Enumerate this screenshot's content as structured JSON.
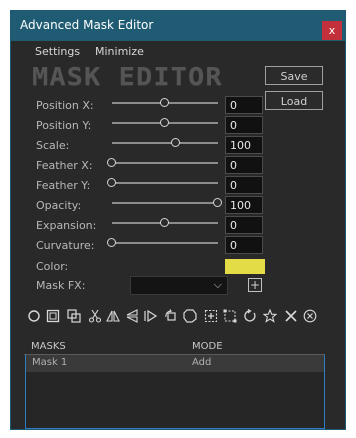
{
  "window": {
    "title": "Advanced Mask Editor",
    "close_label": "x"
  },
  "menu": {
    "settings": "Settings",
    "minimize": "Minimize"
  },
  "logo": "MASK EDITOR",
  "buttons": {
    "save": "Save",
    "load": "Load"
  },
  "params": [
    {
      "label": "Position X:",
      "value": "0",
      "level": 0.5
    },
    {
      "label": "Position Y:",
      "value": "0",
      "level": 0.5
    },
    {
      "label": "Scale:",
      "value": "100",
      "level": 0.6
    },
    {
      "label": "Feather X:",
      "value": "0",
      "level": 0.0
    },
    {
      "label": "Feather Y:",
      "value": "0",
      "level": 0.0
    },
    {
      "label": "Opacity:",
      "value": "100",
      "level": 1.0
    },
    {
      "label": "Expansion:",
      "value": "0",
      "level": 0.5
    },
    {
      "label": "Curvature:",
      "value": "0",
      "level": 0.0
    }
  ],
  "color": {
    "label": "Color:",
    "value": "#e4dc46"
  },
  "mask_fx": {
    "label": "Mask FX:",
    "selected": "",
    "add_label": "+"
  },
  "toolbar": [
    "ellipse-tool-icon",
    "rectangle-tool-icon",
    "duplicate-icon",
    "cut-icon",
    "flip-horizontal-icon",
    "flip-vertical-icon",
    "arrow-play-icon",
    "rotate-shape-icon",
    "subtract-shape-icon",
    "add-point-icon",
    "select-points-icon",
    "refresh-icon",
    "star-icon",
    "close-icon",
    "cancel-circle-icon"
  ],
  "masks_table": {
    "columns": [
      "MASKS",
      "MODE"
    ],
    "rows": [
      {
        "name": "Mask 1",
        "mode": "Add"
      }
    ]
  },
  "colors": {
    "titlebar": "#1f5c74",
    "close": "#c1303b",
    "list_border": "#2f7cc2"
  }
}
